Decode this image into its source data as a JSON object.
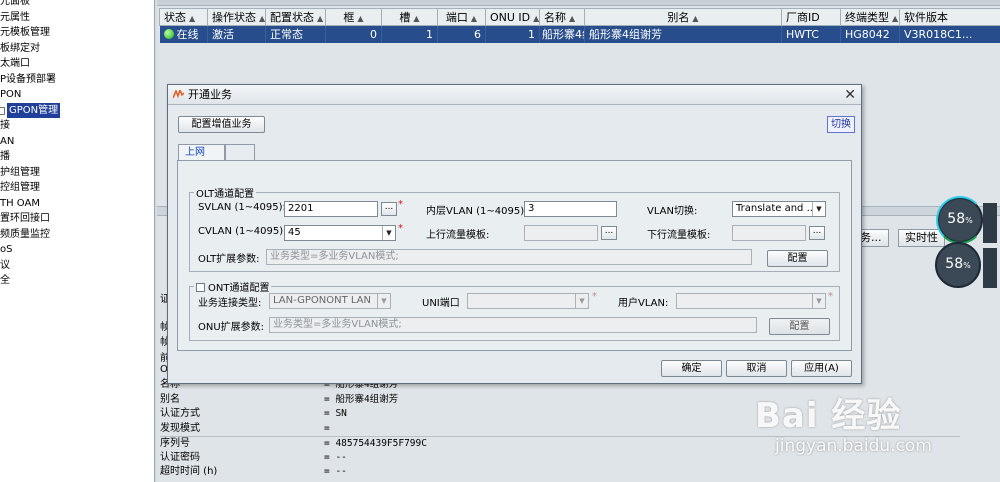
{
  "tree": {
    "items": [
      {
        "label": "元面板"
      },
      {
        "label": "元属性"
      },
      {
        "label": "元模板管理"
      },
      {
        "label": "板绑定对"
      },
      {
        "label": "太端口"
      },
      {
        "label": "P设备预部署"
      },
      {
        "label": "PON"
      },
      {
        "label": "GPON管理",
        "selected": true
      },
      {
        "label": "接"
      },
      {
        "label": "AN"
      },
      {
        "label": "播"
      },
      {
        "label": "护组管理"
      },
      {
        "label": "控组管理"
      },
      {
        "label": "TH OAM"
      },
      {
        "label": "置环回接口"
      },
      {
        "label": "频质量监控"
      },
      {
        "label": "oS"
      },
      {
        "label": "议"
      },
      {
        "label": "全"
      }
    ]
  },
  "onu_table": {
    "columns": [
      "状态",
      "操作状态",
      "配置状态",
      "框",
      "槽",
      "端口",
      "ONU ID",
      "名称",
      "别名",
      "厂商ID",
      "终端类型",
      "软件版本"
    ],
    "row": {
      "status": "在线",
      "op_status": "激活",
      "config_status": "正常态",
      "frame": "0",
      "slot": "1",
      "port": "6",
      "onu_id": "1",
      "name": "船形寨4组...",
      "alias": "船形寨4组谢芳",
      "vendor": "HWTC",
      "terminal_type": "HG8042",
      "software": "V3R018C1..."
    }
  },
  "side_buttons": {
    "b1": "务...",
    "b2": "实时性"
  },
  "details": {
    "rows": [
      {
        "key": "名称",
        "value": "= 船形寨4组谢芳"
      },
      {
        "key": "别名",
        "value": "= 船形寨4组谢芳"
      },
      {
        "key": "认证方式",
        "value": "= SN"
      },
      {
        "key": "发现模式",
        "value": "="
      },
      {
        "key": "序列号",
        "value": "= 485754439F5F799C"
      },
      {
        "key": "认证密码",
        "value": "= --"
      },
      {
        "key": "超时时间 (h)",
        "value": "= --"
      }
    ],
    "partial_labels": [
      "证",
      "帧",
      "帧",
      "前",
      "O"
    ]
  },
  "dialog": {
    "title": "开通业务",
    "value_added_btn": "配置增值业务",
    "switch_btn": "切换",
    "tabs": [
      {
        "label": "上网"
      },
      {
        "label": ""
      }
    ],
    "olt": {
      "legend": "OLT通道配置",
      "svlan_label": "SVLAN (1~4095):",
      "svlan_value": "2201",
      "inner_vlan_label": "内层VLAN (1~4095):",
      "inner_vlan_value": "3",
      "vlan_switch_label": "VLAN切换:",
      "vlan_switch_value": "Translate and ...",
      "cvlan_label": "CVLAN (1~4095):",
      "cvlan_value": "45",
      "up_template_label": "上行流量模板:",
      "down_template_label": "下行流量模板:",
      "ext_label": "OLT扩展参数:",
      "ext_placeholder": "业务类型=多业务VLAN模式;",
      "config_btn": "配置"
    },
    "ont": {
      "legend": "ONT通道配置",
      "conn_type_label": "业务连接类型:",
      "conn_type_value": "LAN-GPONONT LAN",
      "uni_label": "UNI端口",
      "user_vlan_label": "用户VLAN:",
      "ext_label": "ONU扩展参数:",
      "ext_placeholder": "业务类型=多业务VLAN模式;",
      "config_btn": "配置"
    },
    "ok_btn": "确定",
    "cancel_btn": "取消",
    "apply_btn": "应用(A)",
    "button_dots": "...",
    "required_mark": "*"
  },
  "overlay": {
    "gauge1": "58",
    "gauge2": "58",
    "percent": "%",
    "watermark_main": "Bai 经验",
    "watermark_sub": "jingyan.baidu.com"
  },
  "colors": {
    "selection": "#284d8c",
    "online": "#22b11c"
  }
}
